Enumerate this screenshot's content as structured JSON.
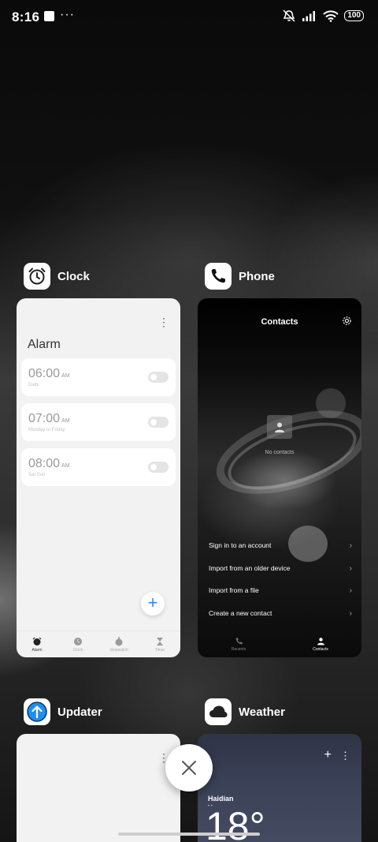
{
  "status_bar": {
    "time": "8:16",
    "dots": "···",
    "battery": "100",
    "icons": [
      "notification-square-icon",
      "more-dots-icon",
      "mute-icon",
      "signal-icon",
      "wifi-icon",
      "battery-icon"
    ]
  },
  "cards": {
    "clock": {
      "app_name": "Clock",
      "icon": "alarm-clock-icon",
      "title": "Alarm",
      "alarms": [
        {
          "time": "06:00",
          "ampm": "AM",
          "label": "Daily"
        },
        {
          "time": "07:00",
          "ampm": "AM",
          "label": "Monday to Friday"
        },
        {
          "time": "08:00",
          "ampm": "AM",
          "label": "Sat Sun"
        }
      ],
      "add_label": "+",
      "nav": [
        "Alarm",
        "Clock",
        "Stopwatch",
        "Timer"
      ]
    },
    "phone": {
      "app_name": "Phone",
      "icon": "phone-icon",
      "title": "Contacts",
      "empty_text": "No contacts",
      "rows": [
        "Sign in to an account",
        "Import from an older device",
        "Import from a file",
        "Create a new contact"
      ],
      "nav": [
        "Recents",
        "Contacts"
      ]
    },
    "updater": {
      "app_name": "Updater",
      "icon": "updater-arrow-icon"
    },
    "weather": {
      "app_name": "Weather",
      "icon": "cloud-icon",
      "city": "Haidian",
      "dots": "• •",
      "temp": "18°"
    }
  },
  "colors": {
    "accent_blue": "#2e86f5",
    "updater_blue": "#1e8ff0"
  }
}
